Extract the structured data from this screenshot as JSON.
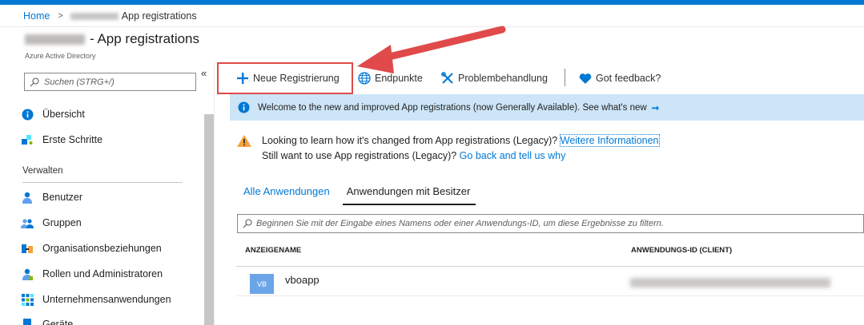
{
  "breadcrumb": {
    "home": "Home",
    "current": "App registrations"
  },
  "header": {
    "title": "- App registrations",
    "subtitle": "Azure Active Directory"
  },
  "sidebar": {
    "collapse": "«",
    "search_placeholder": "Suchen (STRG+/)",
    "items_top": [
      {
        "label": "Übersicht",
        "icon": "info-icon"
      },
      {
        "label": "Erste Schritte",
        "icon": "quickstart-icon"
      }
    ],
    "section": "Verwalten",
    "items_manage": [
      {
        "label": "Benutzer",
        "icon": "user-icon"
      },
      {
        "label": "Gruppen",
        "icon": "groups-icon"
      },
      {
        "label": "Organisationsbeziehungen",
        "icon": "org-relations-icon"
      },
      {
        "label": "Rollen und Administratoren",
        "icon": "roles-icon"
      },
      {
        "label": "Unternehmensanwendungen",
        "icon": "enterprise-apps-icon"
      },
      {
        "label": "Geräte",
        "icon": "devices-icon"
      }
    ]
  },
  "toolbar": {
    "new_registration": "Neue Registrierung",
    "endpoints": "Endpunkte",
    "troubleshooting": "Problembehandlung",
    "feedback": "Got feedback?"
  },
  "banner": {
    "text": "Welcome to the new and improved App registrations (now Generally Available). See what's new"
  },
  "notice": {
    "line1": "Looking to learn how it's changed from App registrations (Legacy)?",
    "line1_link": "Weitere Informationen",
    "line2": "Still want to use App registrations (Legacy)?",
    "line2_link": "Go back and tell us why"
  },
  "tabs": {
    "all": "Alle Anwendungen",
    "owned": "Anwendungen mit Besitzer"
  },
  "filter": {
    "placeholder": "Beginnen Sie mit der Eingabe eines Namens oder einer Anwendungs-ID, um diese Ergebnisse zu filtern."
  },
  "table": {
    "columns": [
      "ANZEIGENAME",
      "ANWENDUNGS-ID (CLIENT)"
    ],
    "rows": [
      {
        "initials": "VB",
        "name": "vboapp"
      }
    ]
  },
  "colors": {
    "accent": "#0078d4",
    "highlight": "#e04a4a",
    "banner": "#cce5f7"
  }
}
